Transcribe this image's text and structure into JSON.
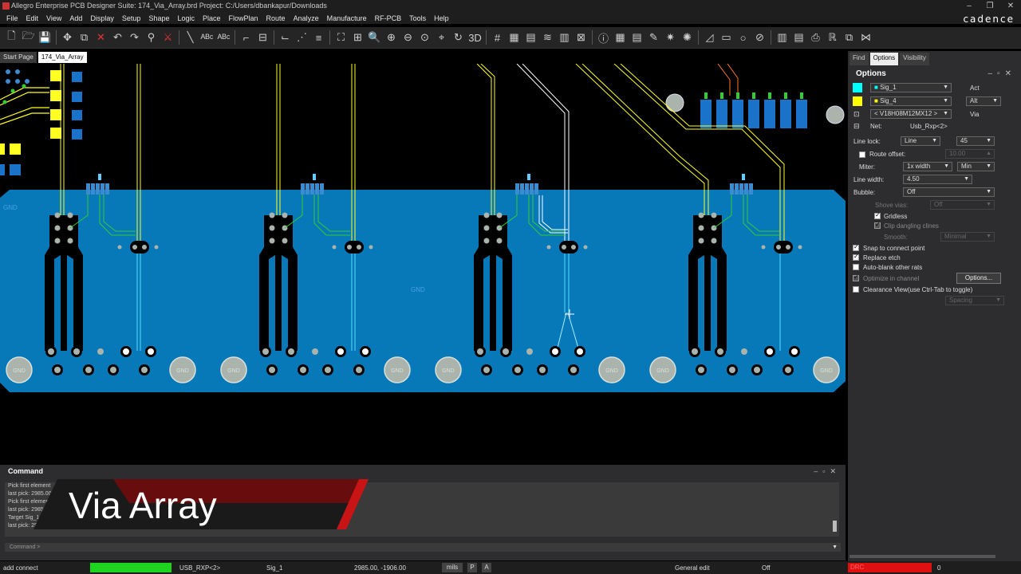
{
  "window": {
    "title": "Allegro Enterprise PCB Designer Suite: 174_Via_Array.brd  Project: C:/Users/dbankapur/Downloads",
    "brand": "cadence"
  },
  "menu": [
    "File",
    "Edit",
    "View",
    "Add",
    "Display",
    "Setup",
    "Shape",
    "Logic",
    "Place",
    "FlowPlan",
    "Route",
    "Analyze",
    "Manufacture",
    "RF-PCB",
    "Tools",
    "Help"
  ],
  "tabs": {
    "start": "Start Page",
    "file": "174_Via_Array"
  },
  "canvas": {
    "gnd_label": "GND",
    "net_label": "GND"
  },
  "panel": {
    "tabs": {
      "find": "Find",
      "options": "Options",
      "visibility": "Visibility"
    },
    "title": "Options",
    "act_layer": "Sig_1",
    "act_label": "Act",
    "alt_layer": "Sig_4",
    "alt_label": "Alt",
    "alt_value": "Alt",
    "via": "< V18H08M12MX12 >",
    "via_label": "Via",
    "net_label": "Net:",
    "net_value": "Usb_Rxp<2>",
    "line_lock_label": "Line lock:",
    "line_lock": "Line",
    "line_lock_angle": "45",
    "route_offset_label": "Route offset:",
    "route_offset": "10.00",
    "miter_label": "Miter:",
    "miter": "1x width",
    "miter_min": "Min",
    "line_width_label": "Line width:",
    "line_width": "4.50",
    "bubble_label": "Bubble:",
    "bubble": "Off",
    "shove_vias_label": "Shove vias:",
    "shove_vias": "Off",
    "gridless": "Gridless",
    "clip_dangling": "Clip dangling clines",
    "smooth_label": "Smooth:",
    "smooth": "Minimal",
    "snap": "Snap to connect point",
    "replace_etch": "Replace etch",
    "auto_blank": "Auto-blank other rats",
    "optimize": "Optimize in channel",
    "options_button": "Options...",
    "clearance": "Clearance View(use Ctrl-Tab to toggle)",
    "spacing": "Spacing",
    "colors": {
      "act": "#00ffff",
      "alt": "#ffff00"
    }
  },
  "command": {
    "title": "Command",
    "log": [
      "Pick first element",
      "last pick:  2985.00 -1906.00",
      "Pick first element",
      "last pick:  2985.00 -1906.00",
      "Target Sig_1",
      "last pick:  2957.04 -1896.65"
    ],
    "input_label": "Command >"
  },
  "banner": {
    "text": "Via Array"
  },
  "status": {
    "mode": "add connect",
    "net": "USB_RXP<2>",
    "layer": "Sig_1",
    "coords": "2985.00, -1906.00",
    "units": "mils",
    "p": "P",
    "a": "A",
    "edit": "General edit",
    "off": "Off",
    "drc": "DRC",
    "count": "0"
  }
}
